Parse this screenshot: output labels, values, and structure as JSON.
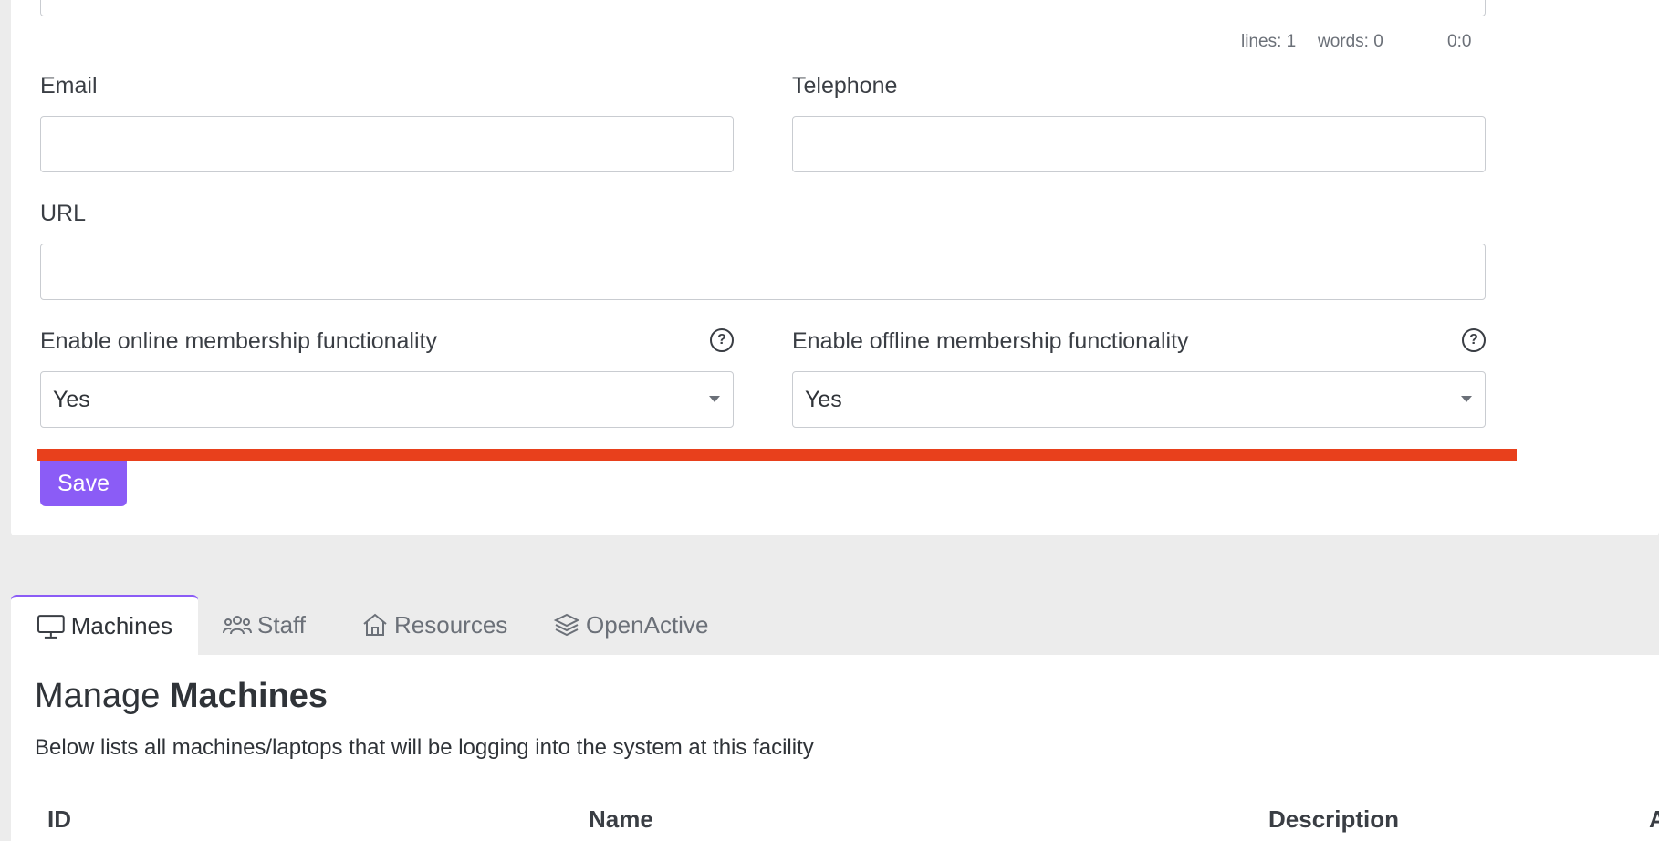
{
  "editor_status": {
    "lines": "lines: 1",
    "words": "words: 0",
    "cursor": "0:0"
  },
  "form": {
    "email_label": "Email",
    "email_value": "",
    "telephone_label": "Telephone",
    "telephone_value": "",
    "url_label": "URL",
    "url_value": "",
    "online_label": "Enable online membership functionality",
    "online_value": "Yes",
    "offline_label": "Enable offline membership functionality",
    "offline_value": "Yes",
    "help_glyph": "?",
    "save_label": "Save"
  },
  "tabs": [
    {
      "label": "Machines",
      "icon": "monitor-icon",
      "active": true
    },
    {
      "label": "Staff",
      "icon": "people-icon",
      "active": false
    },
    {
      "label": "Resources",
      "icon": "house-icon",
      "active": false
    },
    {
      "label": "OpenActive",
      "icon": "layers-icon",
      "active": false
    }
  ],
  "panel": {
    "title_prefix": "Manage ",
    "title_bold": "Machines",
    "subtitle": "Below lists all machines/laptops that will be logging into the system at this facility",
    "columns": [
      "ID",
      "Name",
      "Description",
      "A"
    ]
  },
  "colors": {
    "accent": "#8b5cf6",
    "highlight_bar": "#e8401c"
  }
}
